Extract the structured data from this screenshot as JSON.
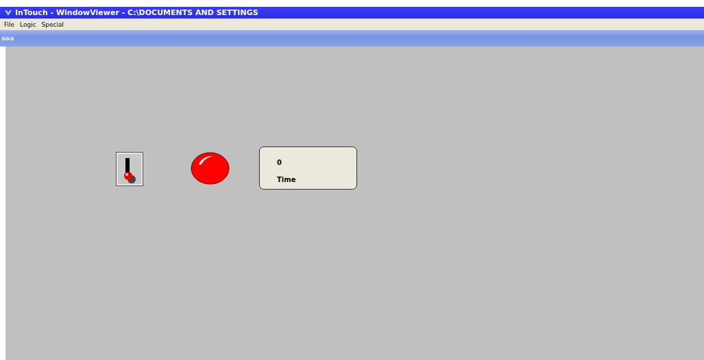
{
  "window": {
    "title": "InTouch - WindowViewer - C:\\DOCUMENTS AND SETTINGS"
  },
  "menu": [
    "File",
    "Logic",
    "Special"
  ],
  "view_window": {
    "title": "aaa"
  },
  "switch": {
    "on": false
  },
  "display": {
    "value": "0",
    "label": "Time"
  }
}
